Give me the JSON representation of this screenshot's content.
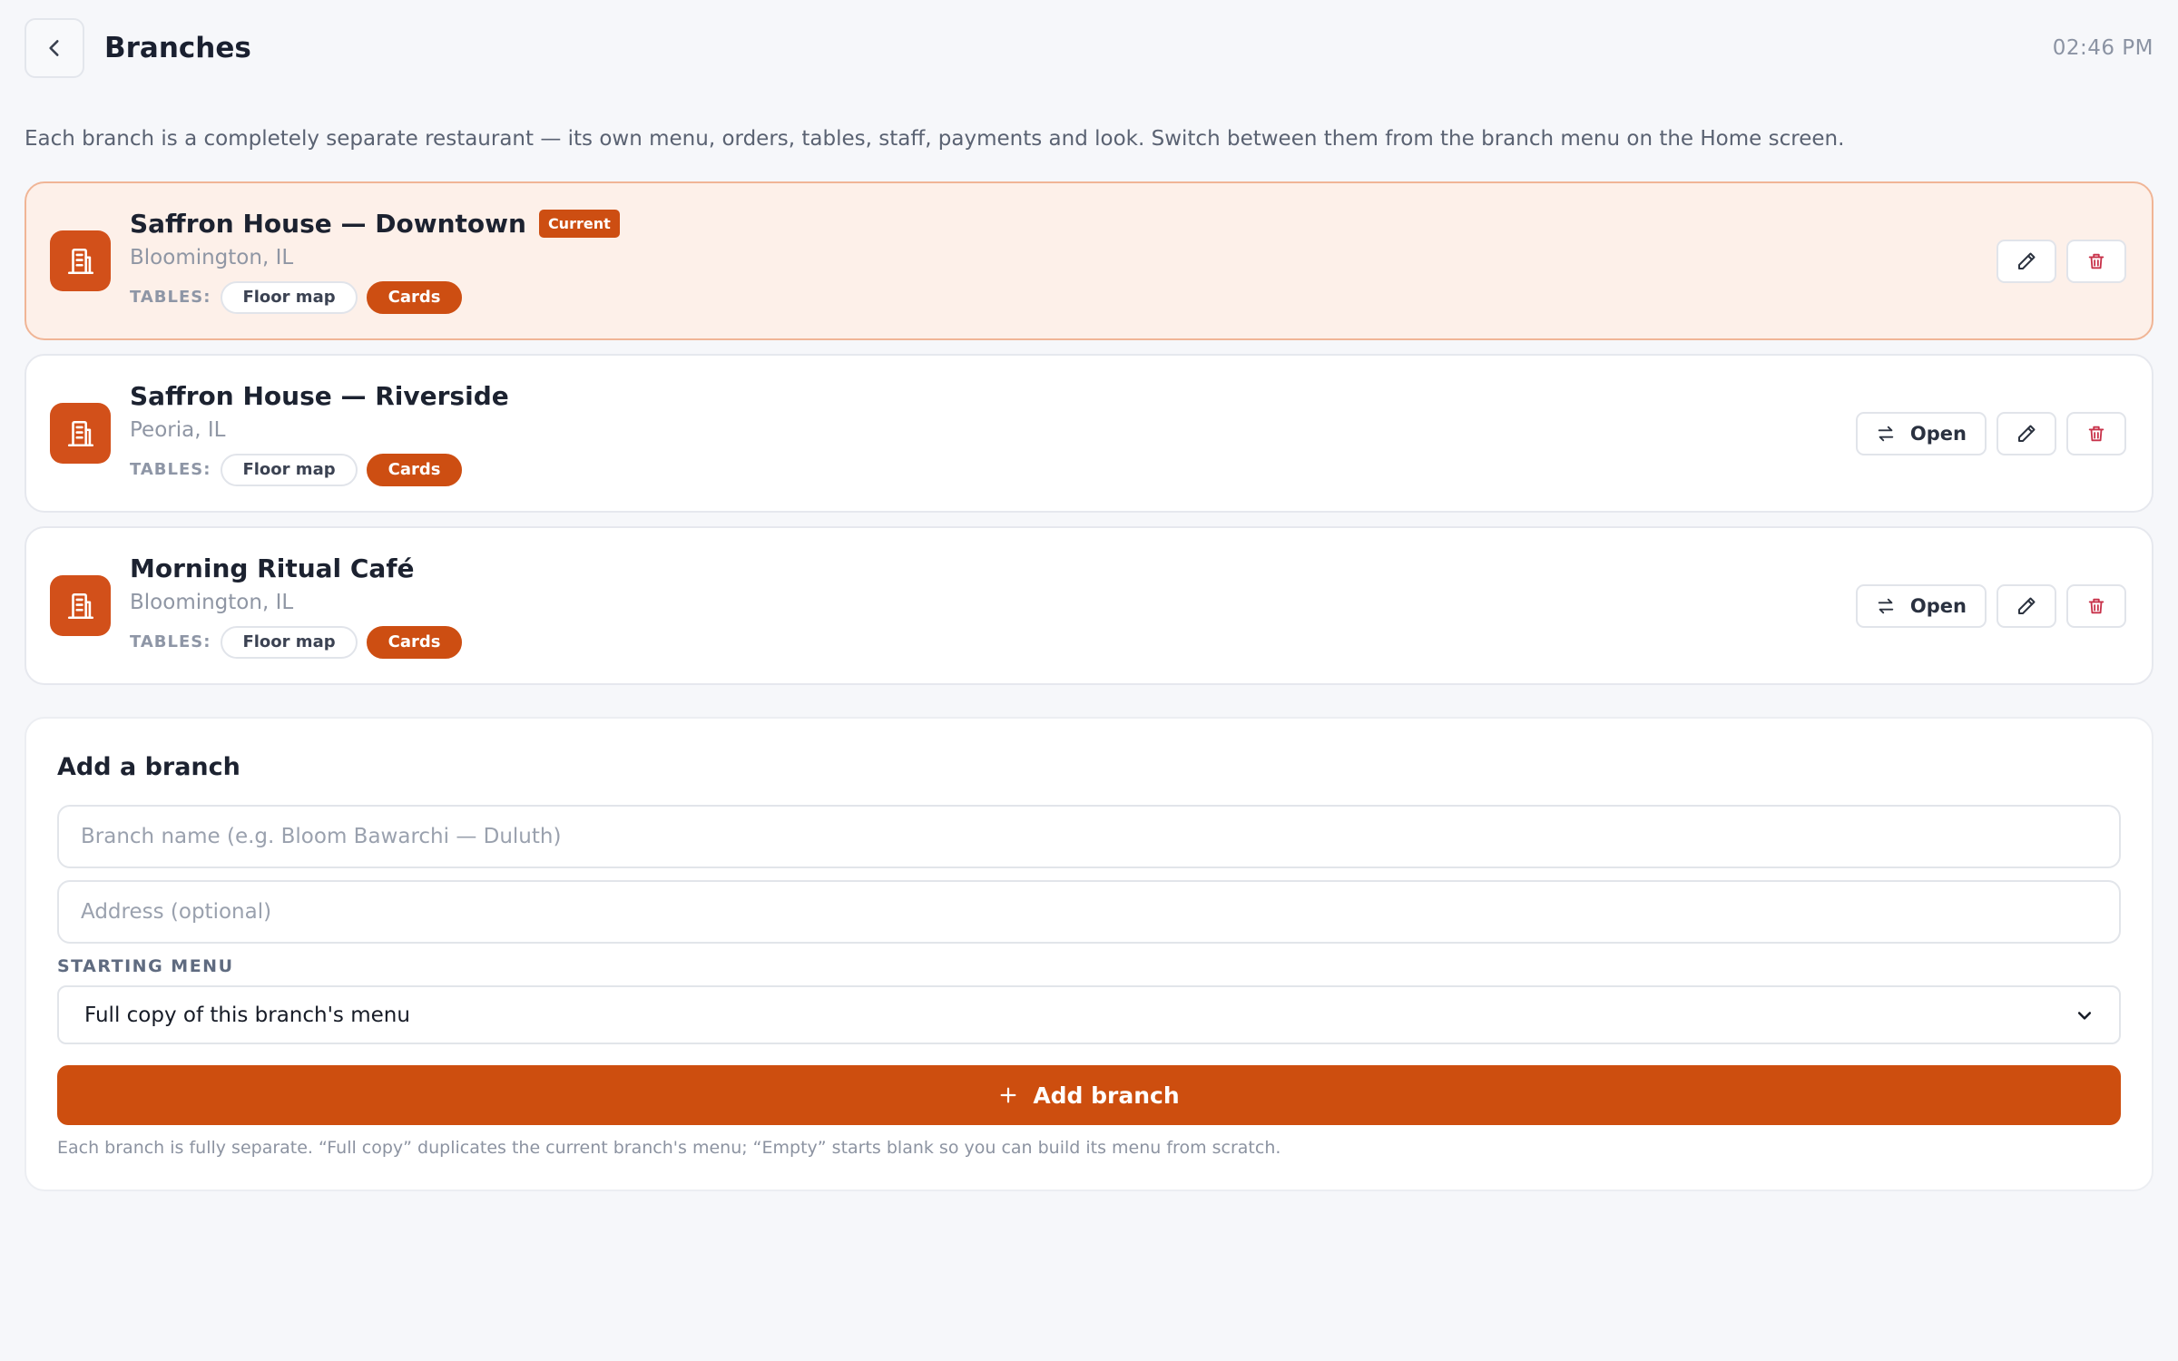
{
  "header": {
    "title": "Branches",
    "time": "02:46 PM"
  },
  "intro": "Each branch is a completely separate restaurant — its own menu, orders, tables, staff, payments and look. Switch between them from the branch menu on the Home screen.",
  "branches": [
    {
      "name": "Saffron House — Downtown",
      "badge": "Current",
      "address": "Bloomington, IL",
      "tables_label": "TABLES:",
      "options": [
        "Floor map",
        "Cards"
      ],
      "selected_option": "Cards"
    },
    {
      "name": "Saffron House — Riverside",
      "address": "Peoria, IL",
      "tables_label": "TABLES:",
      "options": [
        "Floor map",
        "Cards"
      ],
      "selected_option": "Cards",
      "open_label": "Open"
    },
    {
      "name": "Morning Ritual Café",
      "address": "Bloomington, IL",
      "tables_label": "TABLES:",
      "options": [
        "Floor map",
        "Cards"
      ],
      "selected_option": "Cards",
      "open_label": "Open"
    }
  ],
  "add_branch": {
    "title": "Add a branch",
    "name_value": "",
    "name_placeholder": "Branch name (e.g. Bloom Bawarchi — Duluth)",
    "address_value": "",
    "address_placeholder": "Address (optional)",
    "menu_label": "STARTING MENU",
    "menu_selected": "Full copy of this branch's menu",
    "button_label": "Add branch",
    "footnote": "Each branch is fully separate. “Full copy” duplicates the current branch's menu; “Empty” starts blank so you can build its menu from scratch."
  },
  "colors": {
    "accent": "#cd4e12",
    "current_bg": "#fdf0e9",
    "current_border": "#f0b596",
    "delete_red": "#c8324a",
    "background": "#f6f7fa"
  },
  "icons": {
    "back": "chevron-left-icon",
    "branch": "building-icon",
    "switch": "arrows-swap-icon",
    "edit": "pencil-icon",
    "delete": "trash-icon",
    "add": "plus-icon",
    "select": "chevron-down-icon"
  }
}
